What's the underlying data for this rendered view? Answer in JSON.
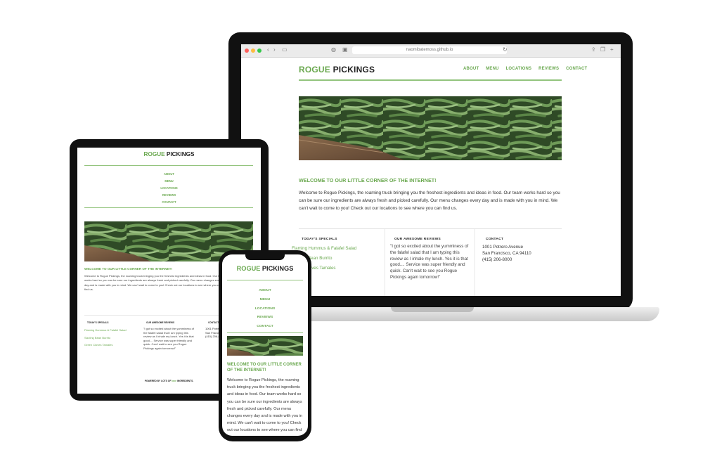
{
  "site": {
    "brand_first": "ROGUE",
    "brand_second": "PICKINGS",
    "nav": [
      "ABOUT",
      "MENU",
      "LOCATIONS",
      "REVIEWS",
      "CONTACT"
    ],
    "welcome": "WELCOME TO OUR LITTLE CORNER OF THE INTERNET!",
    "intro": "Welcome to Rogue Pickings, the roaming truck bringing you the freshest ingredients and ideas in food. Our team works hard so you can be sure our ingredients are always fresh and picked carefully. Our menu changes every day and is made with you in mind. We can't wait to come to you! Check out our locations to see where you can find us.",
    "specials_heading": "TODAY'S SPECIALS",
    "specials": [
      "Flaming Hummus & Falafel Salad",
      "Sizzling Bean Burrito",
      "Green Cloves Tamales"
    ],
    "reviews_heading": "OUR AWESOME REVIEWS",
    "review": "\"I got so excited about the yumminess of the falafel salad that I am typing this review as I inhale my lunch. Yes it is that good.... Service was super friendly and quick. Can't wait to see you Rogue Pickings again tomorrow!\"",
    "contact_heading": "CONTACT",
    "contact_lines": [
      "1001 Potrero Avenue",
      "San Francisco, CA 94110",
      "(415) 206-8000"
    ],
    "footer_prefix": "POWERED BY LOTS OF",
    "footer_mid": "love",
    "footer_suffix": "INGREDIENTS."
  },
  "browser": {
    "url": "naomibatemoss.github.io"
  },
  "colors": {
    "brand_green": "#6aa84f",
    "rule_green": "#93c47d",
    "device_frame": "#111111"
  },
  "icons": [
    "back-arrow-icon",
    "forward-arrow-icon",
    "sidebar-icon",
    "shield-icon",
    "reader-icon",
    "reload-icon",
    "share-icon",
    "tabs-icon",
    "add-tab-icon"
  ]
}
